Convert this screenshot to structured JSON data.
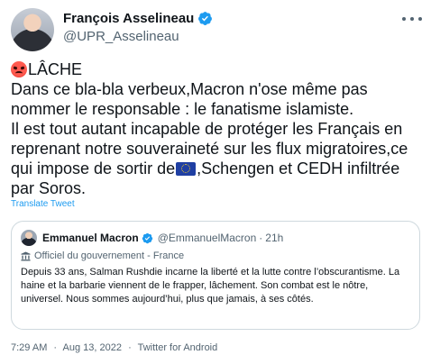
{
  "author": {
    "name": "François Asselineau",
    "handle": "@UPR_Asselineau",
    "verified_icon": "verified-badge-icon"
  },
  "tweet": {
    "line1_text": "LÂCHE",
    "line2": "Dans ce bla-bla verbeux,Macron n'ose même pas",
    "line3": "nommer le responsable : le fanatisme islamiste.",
    "line4": "Il est tout autant incapable de protéger les Français en",
    "line5": "reprenant notre souveraineté sur les flux migratoires,ce",
    "line6_before": "qui impose de sortir de",
    "line6_after": ",Schengen et CEDH infiltrée",
    "line7": "par Soros.",
    "emoji_1": "angry-face-emoji",
    "emoji_2": "eu-flag-emoji",
    "translate_label": "Translate Tweet"
  },
  "quote": {
    "name": "Emmanuel Macron",
    "handle": "@EmmanuelMacron",
    "separator": "·",
    "time": "21h",
    "label": "Officiel du gouvernement - France",
    "text": "Depuis 33 ans, Salman Rushdie incarne la liberté et la lutte contre l’obscurantisme. La haine et la barbarie viennent de le frapper, lâchement. Son combat est le nôtre, universel. Nous sommes aujourd’hui, plus que jamais, à ses côtés."
  },
  "meta": {
    "time": "7:29 AM",
    "sep1": "·",
    "date": "Aug 13, 2022",
    "sep2": "·",
    "client": "Twitter for Android"
  },
  "colors": {
    "link": "#1d9bf0",
    "verified": "#1d9bf0",
    "secondary_text": "#536471",
    "border": "#cfd9de"
  }
}
